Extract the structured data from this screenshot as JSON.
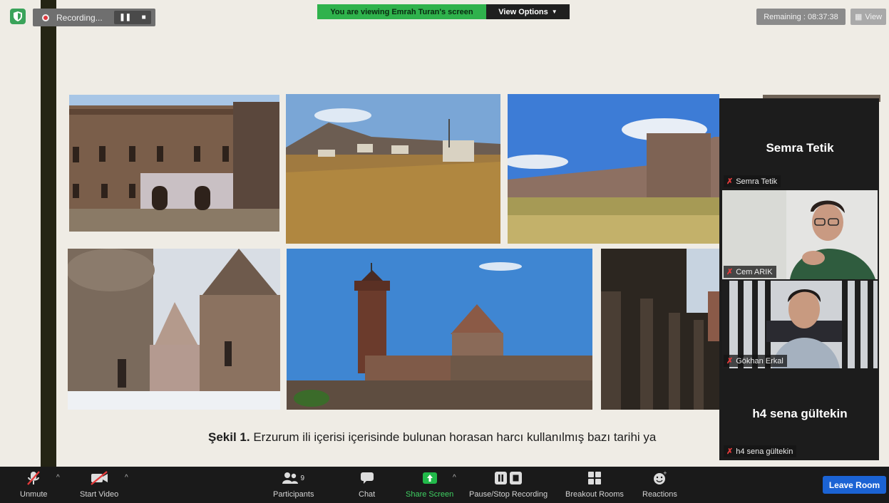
{
  "top_bar": {
    "recording_label": "Recording...",
    "pause_glyph": "❚❚",
    "stop_glyph": "■",
    "viewing_text": "You are viewing Emrah Turan's screen",
    "view_options_label": "View Options",
    "remaining_text": "Remaining : 08:37:38",
    "view_label": "View"
  },
  "slide": {
    "caption_bold": "Şekil 1.",
    "caption_text": " Erzurum ili içerisi içerisinde bulunan horasan harcı kullanılmış bazı tarihi ya"
  },
  "participants_panel": {
    "tiles": [
      {
        "display_name": "Semra Tetik",
        "name_tag": "Semra Tetik"
      },
      {
        "name_tag": "Cem ARIK"
      },
      {
        "name_tag": "Gökhan Erkal"
      },
      {
        "display_name": "h4 sena gültekin",
        "name_tag": "h4 sena gültekin"
      }
    ]
  },
  "toolbar": {
    "unmute": "Unmute",
    "start_video": "Start Video",
    "participants": "Participants",
    "participants_count": "9",
    "chat": "Chat",
    "share_screen": "Share Screen",
    "pause_stop_recording": "Pause/Stop Recording",
    "breakout_rooms": "Breakout Rooms",
    "reactions": "Reactions",
    "leave_room": "Leave Room"
  },
  "colors": {
    "recording_red": "#e0383e",
    "viewing_green": "#2fb24c",
    "share_green": "#22b94a",
    "leave_blue": "#1b63d4",
    "mic_off_red": "#e63b3b"
  }
}
